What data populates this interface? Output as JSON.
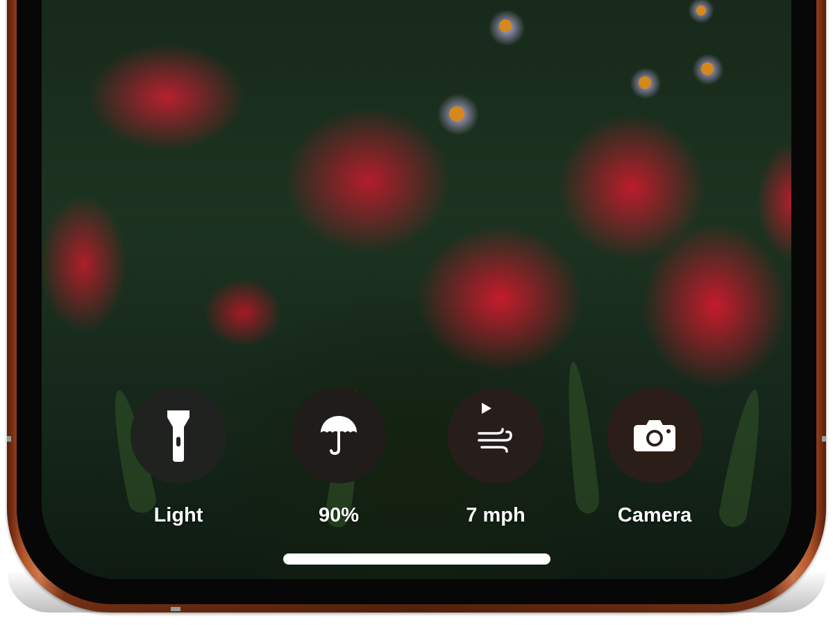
{
  "controls": [
    {
      "id": "light",
      "label": "Light",
      "icon": "flashlight-icon",
      "bg": "#1f221e"
    },
    {
      "id": "humidity",
      "label": "90%",
      "icon": "umbrella-icon",
      "bg": "#1f1c1a"
    },
    {
      "id": "wind",
      "label": "7 mph",
      "icon": "wind-icon",
      "bg": "#271e1c"
    },
    {
      "id": "camera",
      "label": "Camera",
      "icon": "camera-icon",
      "bg": "#2b1d18"
    }
  ],
  "colors": {
    "frame": "#8d3a18",
    "label": "#ffffff",
    "home_indicator": "#ffffff"
  }
}
